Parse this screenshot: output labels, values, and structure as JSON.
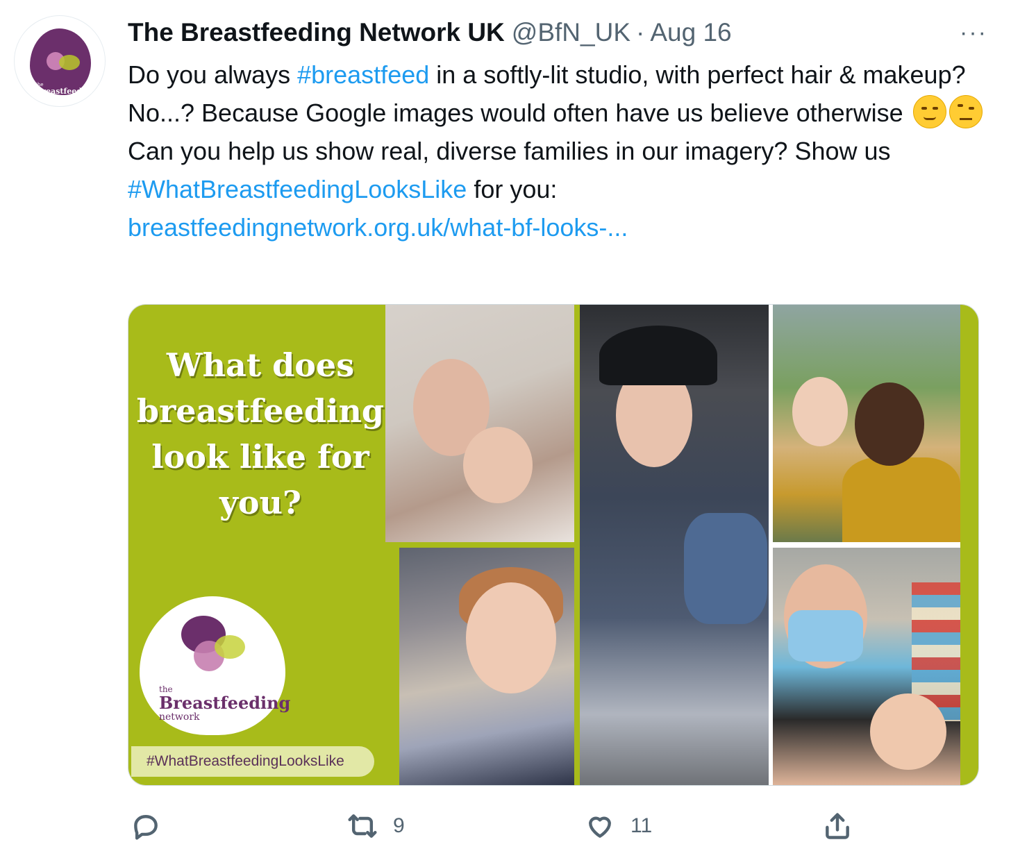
{
  "tweet": {
    "author": {
      "name": "The Breastfeeding Network UK",
      "handle": "@BfN_UK",
      "separator": "·",
      "date": "Aug 16",
      "avatar_text_small": "the",
      "avatar_text_main": "Breastfeeding",
      "avatar_text_sub": "network"
    },
    "more_label": "···",
    "text": {
      "line1_a": "Do you always ",
      "hashtag1": "#breastfeed",
      "line1_b": " in a softly-lit studio, with perfect hair & makeup? No...? Because Google images would often have us believe otherwise",
      "line2_a": "Can you help us show real, diverse families in our imagery? Show us ",
      "hashtag2": "#WhatBreastfeedingLooksLike",
      "line2_b": " for you:",
      "link": "breastfeedingnetwork.org.uk/what-bf-looks-..."
    },
    "emojis": [
      "smirking-face-emoji",
      "face-with-raised-eyebrow-emoji"
    ],
    "media": {
      "headline_line1": "What does",
      "headline_line2": "breastfeeding",
      "headline_line3": "look like for",
      "headline_line4": "you?",
      "logo_small": "the",
      "logo_main": "Breastfeeding",
      "logo_sub": "network",
      "hashtag_pill": "#WhatBreastfeedingLooksLike",
      "accent_green": "#a8bb1a",
      "brand_purple": "#6b2f6b"
    },
    "actions": {
      "reply_count": "",
      "retweet_count": "9",
      "like_count": "11",
      "icons": [
        "reply-icon",
        "retweet-icon",
        "like-icon",
        "share-icon"
      ]
    },
    "link_color": "#1d9bf0"
  }
}
